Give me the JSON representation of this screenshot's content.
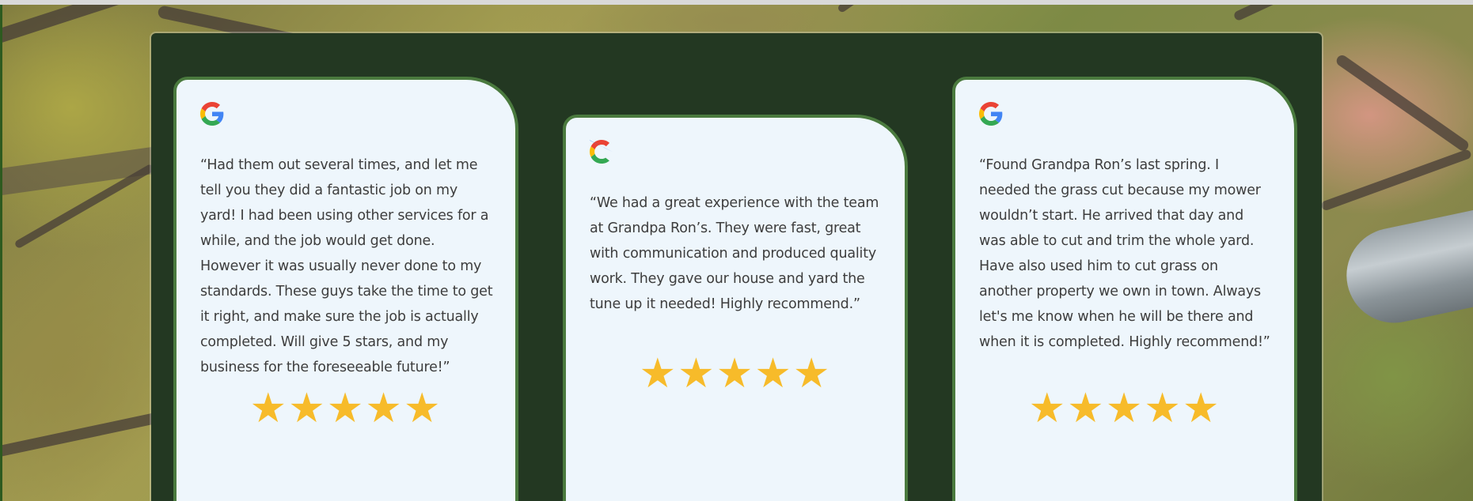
{
  "colors": {
    "panel_background": "#233822",
    "card_background": "#eef6fc",
    "card_border": "#4a7a3e",
    "star": "#f7bb2a",
    "text": "#3d3d3d"
  },
  "reviews": [
    {
      "source_icon": "google-icon",
      "text": "“Had them out several times, and let me tell you they did a fantastic job on my yard! I had been using other services for a while, and the job would get done. However it was usually never done to my standards. These guys take the time to get it right, and make sure the job is actually completed. Will give 5 stars, and my business for the foreseeable future!”",
      "rating": 5,
      "stars": "★★★★★"
    },
    {
      "source_icon": "google-icon",
      "text": "“We had a great experience with the team at Grandpa Ron’s. They were fast, great with communication and produced quality work. They gave our house and yard the tune up it needed! Highly recommend.”",
      "rating": 5,
      "stars": "★★★★★"
    },
    {
      "source_icon": "google-icon",
      "text": "“Found Grandpa Ron’s last spring. I needed the grass cut because my mower wouldn’t start. He arrived that day and was able to cut and trim the whole yard. Have also used him to cut grass on another property we own in town. Always let's me know when he will be there and when it is completed. Highly recommend!”",
      "rating": 5,
      "stars": "★★★★★"
    }
  ]
}
